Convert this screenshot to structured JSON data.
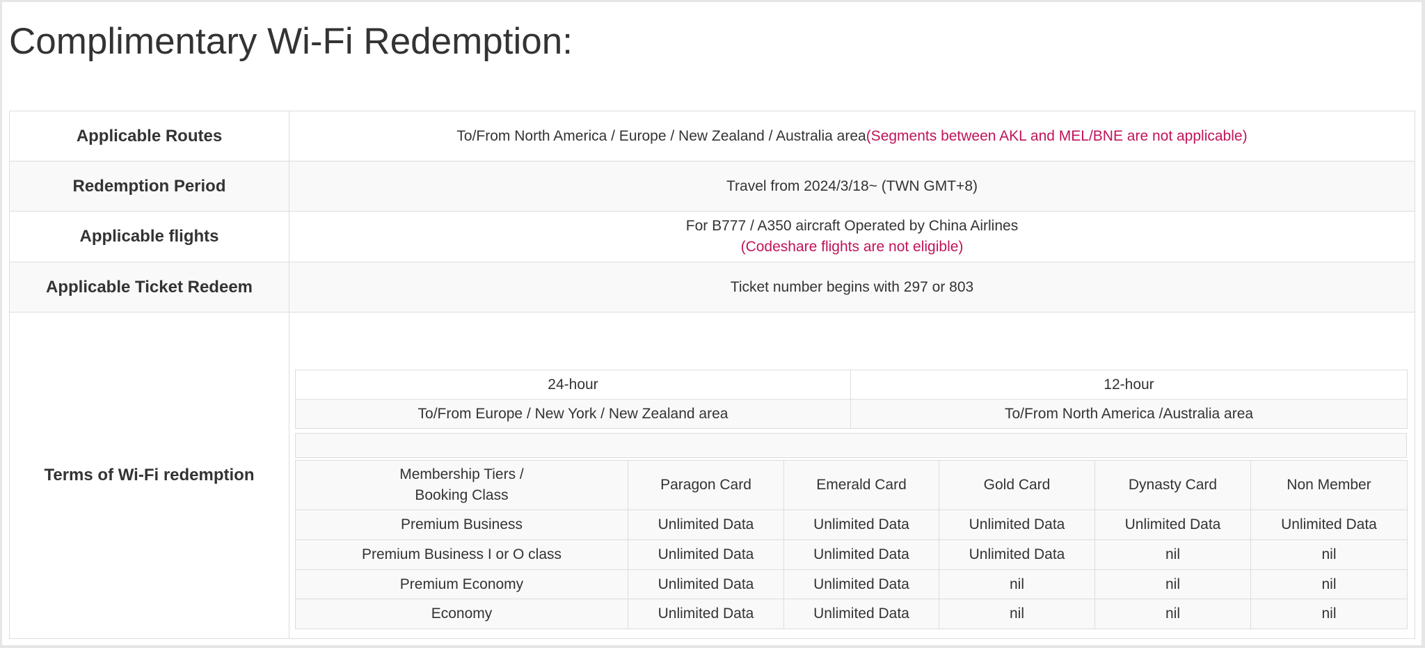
{
  "title": "Complimentary Wi-Fi Redemption:",
  "rows": {
    "routes": {
      "label": "Applicable Routes",
      "value": "To/From North America / Europe / New Zealand / Australia area",
      "note": "(Segments between AKL and MEL/BNE are not applicable)"
    },
    "period": {
      "label": "Redemption Period",
      "value": "Travel from 2024/3/18~ (TWN GMT+8)"
    },
    "flights": {
      "label": "Applicable flights",
      "value": "For B777 / A350 aircraft Operated by China Airlines",
      "note": "(Codeshare flights are not eligible)"
    },
    "ticket": {
      "label": "Applicable Ticket Redeem",
      "value": "Ticket number begins with 297 or 803"
    },
    "terms": {
      "label": "Terms of Wi-Fi redemption"
    }
  },
  "durations": {
    "headers": [
      "24-hour",
      "12-hour"
    ],
    "areas": [
      "To/From Europe / New York / New Zealand area",
      "To/From North America /Australia area"
    ]
  },
  "tiers": {
    "corner_line1": "Membership Tiers /",
    "corner_line2": "Booking Class",
    "columns": [
      "Paragon Card",
      "Emerald Card",
      "Gold Card",
      "Dynasty Card",
      "Non Member"
    ],
    "rows": [
      {
        "class": "Premium Business",
        "cells": [
          "Unlimited Data",
          "Unlimited Data",
          "Unlimited Data",
          "Unlimited Data",
          "Unlimited Data"
        ]
      },
      {
        "class": "Premium Business I or O class",
        "cells": [
          "Unlimited Data",
          "Unlimited Data",
          "Unlimited Data",
          "nil",
          "nil"
        ]
      },
      {
        "class": "Premium Economy",
        "cells": [
          "Unlimited Data",
          "Unlimited Data",
          "nil",
          "nil",
          "nil"
        ]
      },
      {
        "class": "Economy",
        "cells": [
          "Unlimited Data",
          "Unlimited Data",
          "nil",
          "nil",
          "nil"
        ]
      }
    ]
  },
  "colors": {
    "accent_red": "#c0135a",
    "border": "#dddddd",
    "stripe": "#f9f9f9",
    "text": "#333333"
  }
}
